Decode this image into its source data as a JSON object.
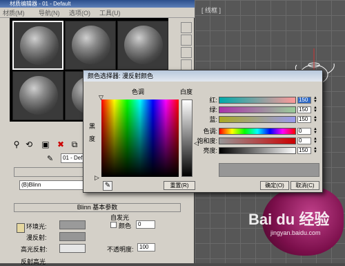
{
  "viewport": {
    "label": "[ 线框 ]"
  },
  "material_editor": {
    "title": "材质编辑器 - 01 - Default",
    "menu": [
      "材质(M)",
      "导航(N)",
      "选项(O)",
      "工具(U)"
    ],
    "material_name": "01 - Def",
    "rollout_shader_header": "明",
    "shader": "(B)Blinn",
    "rollout_basic_header": "Blinn 基本参数",
    "self_illum_label": "自发光",
    "color_check_label": "颜色",
    "self_illum_value": "0",
    "ambient_label": "环境光:",
    "diffuse_label": "漫反射:",
    "specular_label": "高光反射:",
    "opacity_label": "不透明度:",
    "opacity_value": "100",
    "reflect_highlight_label": "反射高光",
    "colors": {
      "ambient": "#9a9a9a",
      "diffuse": "#969696",
      "specular": "#e6e6e6"
    }
  },
  "color_dialog": {
    "title": "颜色选择器: 漫反射颜色",
    "hue_label": "色调",
    "whiteness_label": "白度",
    "black_label": "黑",
    "degree_label": "度",
    "sliders": [
      {
        "label": "红:",
        "value": "150"
      },
      {
        "label": "绿:",
        "value": "150"
      },
      {
        "label": "蓝:",
        "value": "150"
      },
      {
        "label": "色调:",
        "value": "0"
      },
      {
        "label": "饱和度:",
        "value": "0"
      },
      {
        "label": "亮度:",
        "value": "150"
      }
    ],
    "reset_label": "重置(R)",
    "ok_label": "确定(O)",
    "cancel_label": "取消(C)",
    "current_color": "#969696"
  },
  "watermark": {
    "logo": "Bai du 经验",
    "url": "jingyan.baidu.com"
  }
}
